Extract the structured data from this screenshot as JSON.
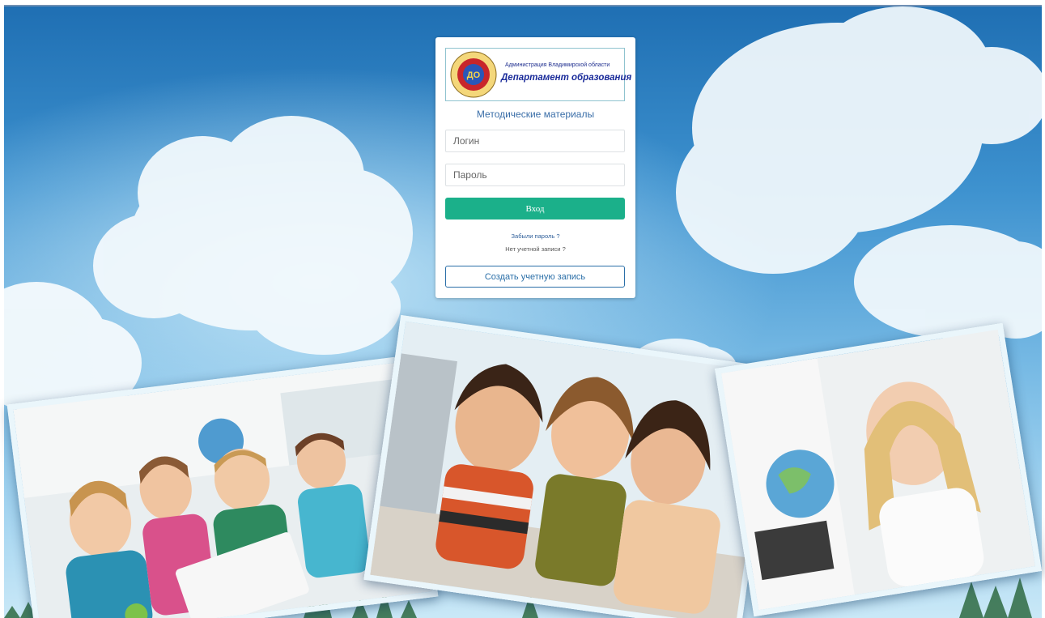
{
  "header": {
    "organization": "Администрация Владимирской области",
    "department": "Департамент образования",
    "emblem_text": "ДЕПАРТАМЕНТ ОБРАЗОВАНИЯ ВЛАДИМИРСКОЙ ОБЛАСТИ",
    "emblem_monogram": "ДО"
  },
  "login_form": {
    "subtitle": "Методические материалы",
    "login_placeholder": "Логин",
    "password_placeholder": "Пароль",
    "submit_label": "Вход",
    "forgot_password": "Забыли пароль ?",
    "no_account": "Нет учетной записи ?",
    "create_account_label": "Создать учетную запись"
  },
  "colors": {
    "primary_button": "#1bb08a",
    "outline_button": "#2b6fa8",
    "link": "#2f5f9a",
    "sky": "#3e92cf"
  },
  "icons": [
    "emblem-logo"
  ]
}
